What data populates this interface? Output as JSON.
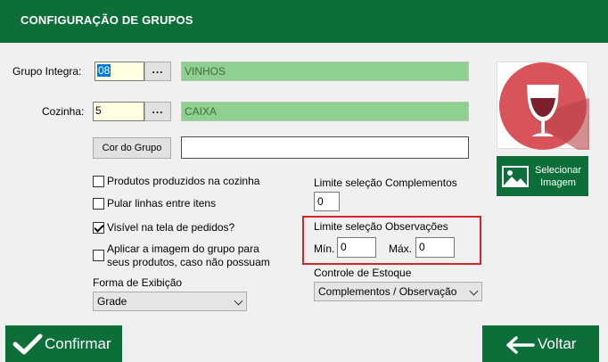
{
  "window": {
    "title": "CONFIGURAÇÃO DE GRUPOS"
  },
  "grupo": {
    "label": "Grupo Integra:",
    "code": "08",
    "lookup_label": "...",
    "description": "VINHOS"
  },
  "cozinha": {
    "label": "Cozinha:",
    "code": "5",
    "lookup_label": "...",
    "description": "CAIXA"
  },
  "cor": {
    "button_label": "Cor do Grupo",
    "value": ""
  },
  "options": [
    {
      "label": "Produtos produzidos na cozinha",
      "checked": false
    },
    {
      "label": "Pular linhas entre itens",
      "checked": false
    },
    {
      "label": "Visível na tela de pedidos?",
      "checked": true
    },
    {
      "label_line1": "Aplicar a imagem do grupo para",
      "label_line2": "seus produtos, caso não possuam",
      "checked": false
    }
  ],
  "forma_exibicao": {
    "label": "Forma de Exibição",
    "value": "Grade"
  },
  "limite_complementos": {
    "label": "Limite seleção Complementos",
    "value": "0"
  },
  "limite_observacoes": {
    "label": "Limite seleção Observações",
    "min_label": "Mín.",
    "min_value": "0",
    "max_label": "Máx.",
    "max_value": "0"
  },
  "controle_estoque": {
    "label": "Controle de Estoque",
    "value": "Complementos / Observação"
  },
  "image": {
    "icon": "wine-glass-icon",
    "circle_color": "#d9535a"
  },
  "select_image_button": {
    "line1": "Selecionar",
    "line2": "Imagem",
    "icon": "image-icon"
  },
  "confirm_button": {
    "label": "Confirmar",
    "icon": "checkmark-icon"
  },
  "back_button": {
    "label": "Voltar",
    "icon": "arrow-left-icon"
  },
  "colors": {
    "brand_green": "#0d6e3a",
    "highlight_red": "#d8232a",
    "desc_field_green": "#8fcf8f",
    "code_field_yellow": "#ffffe1"
  }
}
